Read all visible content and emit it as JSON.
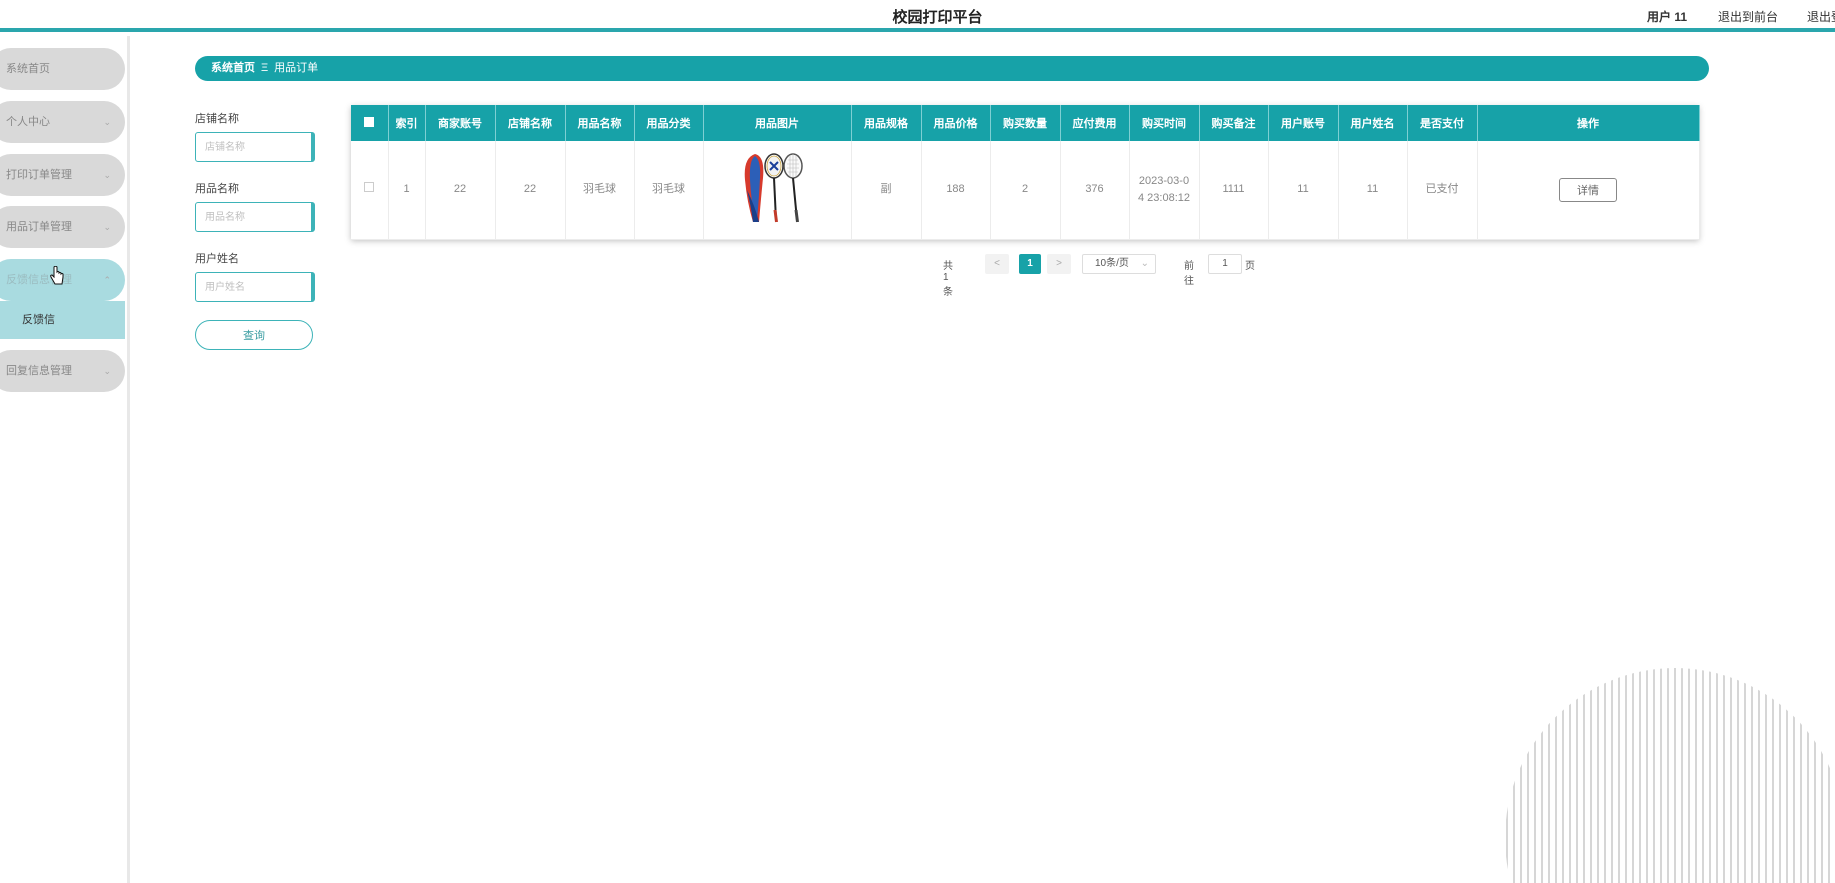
{
  "header": {
    "title": "校园打印平台",
    "user_label": "用户 11",
    "back_to_front": "退出到前台",
    "logout": "退出登"
  },
  "sidebar": {
    "items": [
      {
        "label": "系统首页",
        "has_chevron": false
      },
      {
        "label": "个人中心",
        "has_chevron": true
      },
      {
        "label": "打印订单管理",
        "has_chevron": true
      },
      {
        "label": "用品订单管理",
        "has_chevron": true
      },
      {
        "label": "反馈信息管理",
        "has_chevron": true,
        "expanded": true
      },
      {
        "label": "回复信息管理",
        "has_chevron": true
      }
    ],
    "sub_item": "反馈信",
    "chevron_down": "⌄",
    "chevron_up": "⌃"
  },
  "breadcrumb": {
    "home": "系统首页",
    "separator": "Ξ",
    "current": "用品订单"
  },
  "search": {
    "shop_label": "店铺名称",
    "shop_placeholder": "店铺名称",
    "product_label": "用品名称",
    "product_placeholder": "用品名称",
    "user_label": "用户姓名",
    "user_placeholder": "用户姓名",
    "query_button": "查询"
  },
  "table": {
    "columns": [
      "索引",
      "商家账号",
      "店铺名称",
      "用品名称",
      "用品分类",
      "用品图片",
      "用品规格",
      "用品价格",
      "购买数量",
      "应付费用",
      "购买时间",
      "购买备注",
      "用户账号",
      "用户姓名",
      "是否支付",
      "操作"
    ],
    "rows": [
      {
        "index": "1",
        "merchant_account": "22",
        "shop_name": "22",
        "product_name": "羽毛球",
        "category": "羽毛球",
        "image": "badminton-rackets-image",
        "spec": "副",
        "price": "188",
        "quantity": "2",
        "total": "376",
        "purchase_time_line1": "2023-03-0",
        "purchase_time_line2": "4 23:08:12",
        "remark": "1111",
        "user_account": "11",
        "user_name": "11",
        "paid": "已支付",
        "action": "详情"
      }
    ]
  },
  "pagination": {
    "total": "共 1 条",
    "prev": "<",
    "current_page": "1",
    "next": ">",
    "page_size": "10条/页",
    "goto_label": "前往",
    "goto_value": "1",
    "page_unit": "页"
  },
  "colors": {
    "accent": "#17a2a8",
    "sidebar_item": "#d9d9d9",
    "sidebar_active": "#a9dbe0"
  }
}
